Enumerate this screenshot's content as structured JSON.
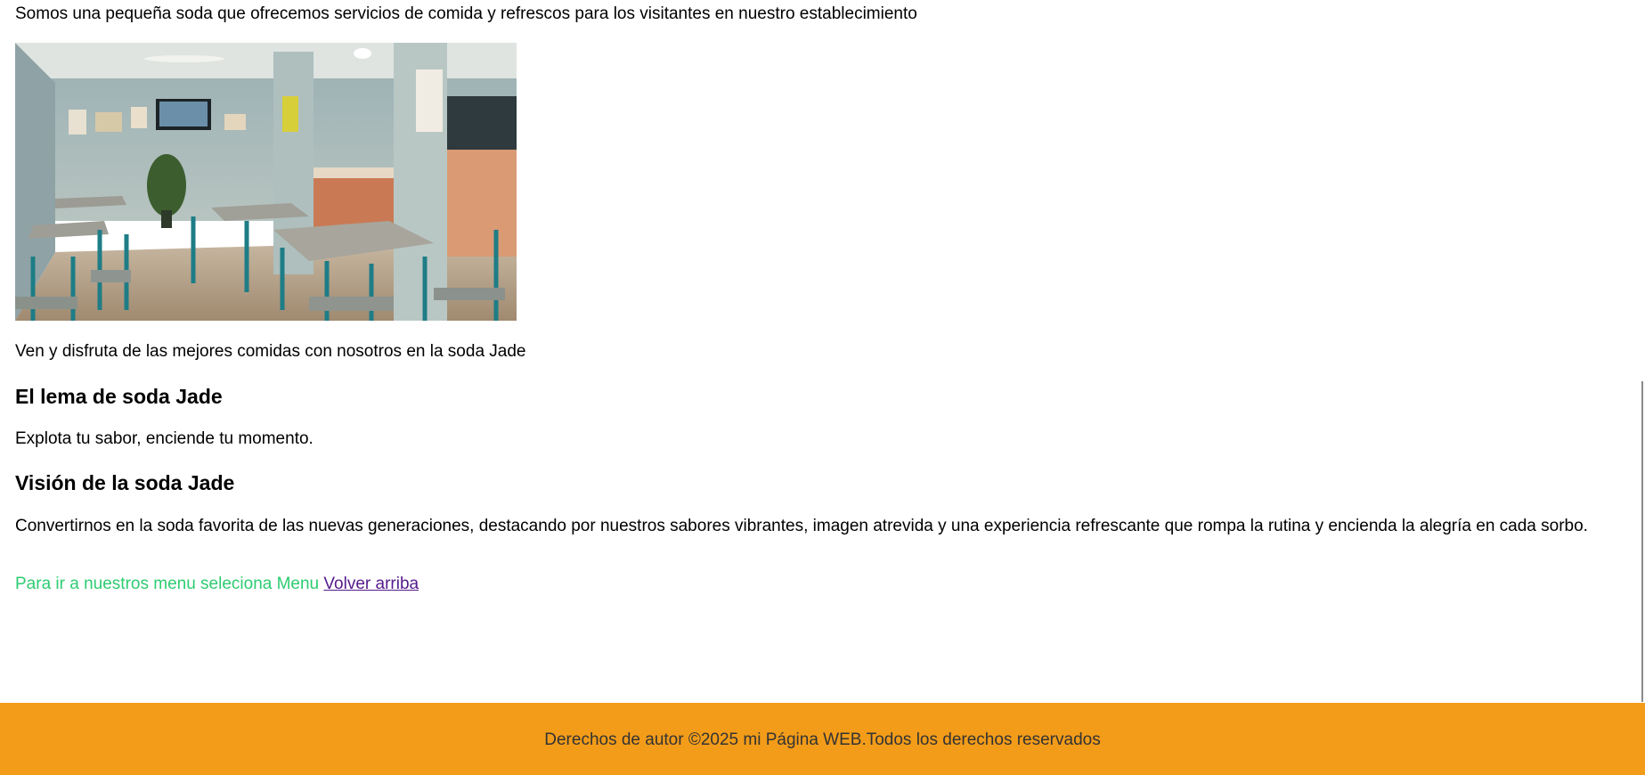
{
  "intro": "Somos una pequeña soda que ofrecemos servicios de comida y refrescos para los visitantes en nuestro establecimiento",
  "invite": "Ven y disfruta de las mejores comidas con nosotros en la soda Jade",
  "lema": {
    "heading": "El lema de soda Jade",
    "text": "Explota tu sabor, enciende tu momento."
  },
  "vision": {
    "heading": "Visión de la soda Jade",
    "text": "Convertirnos en la soda favorita de las nuevas generaciones, destacando por nuestros sabores vibrantes, imagen atrevida y una experiencia refrescante que rompa la rutina y encienda la alegría en cada sorbo."
  },
  "menu_note": {
    "text": "Para ir a nuestros menu seleciona Menu",
    "link": "Volver arriba"
  },
  "footer": {
    "text": "Derechos de autor ©2025 mi Página WEB.Todos los derechos reservados"
  },
  "colors": {
    "footer_bg": "#f39c19",
    "menu_text": "#2ecc71",
    "link": "#551a8b"
  }
}
